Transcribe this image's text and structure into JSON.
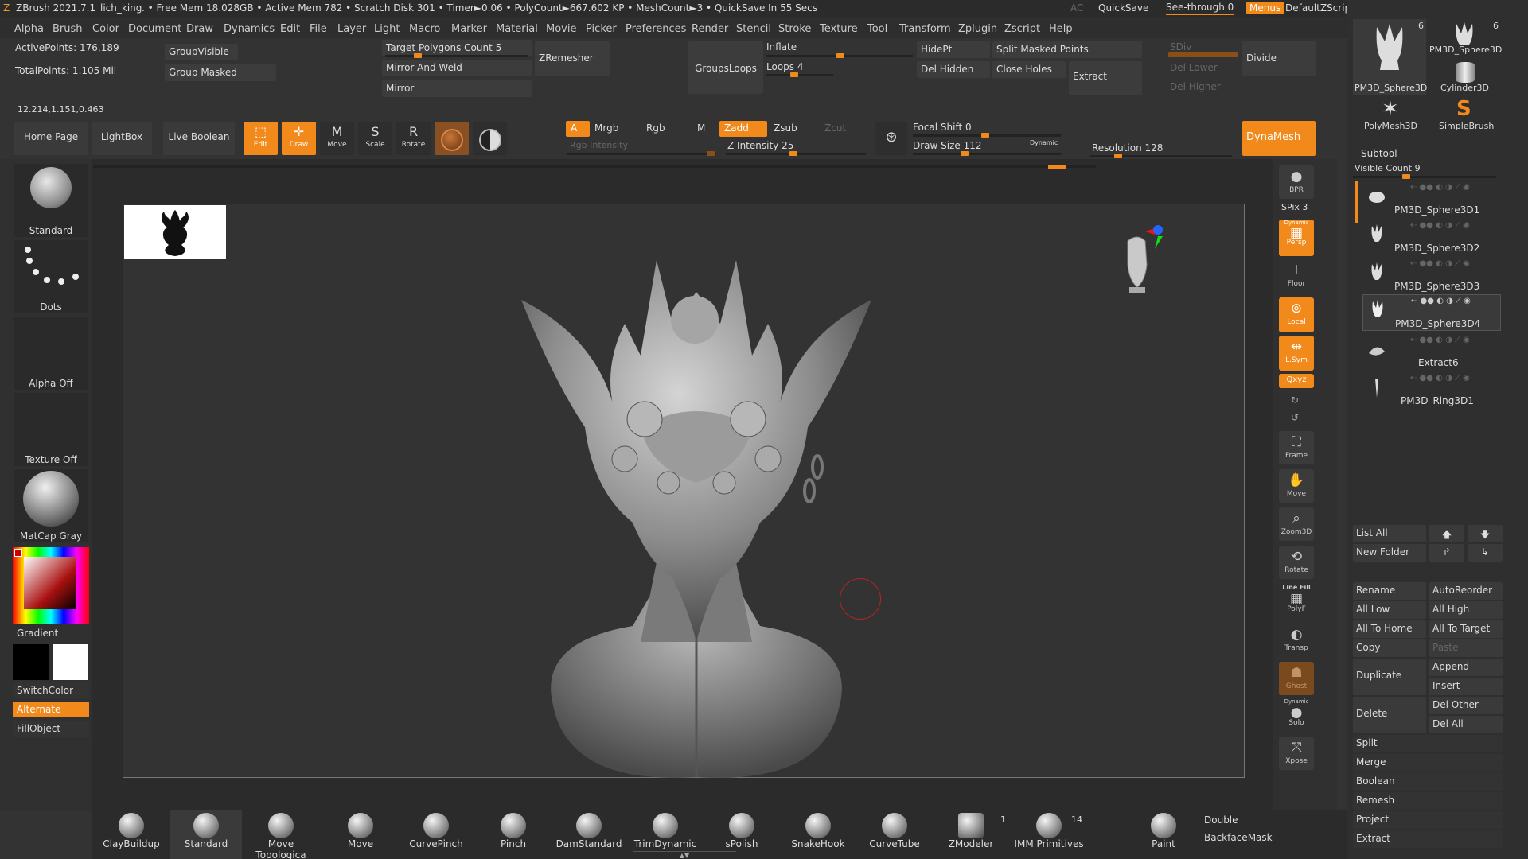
{
  "titlebar": {
    "app": "ZBrush 2021.7.1",
    "project": "lich_king",
    "stats": ". • Free Mem 18.028GB • Active Mem 782 • Scratch Disk 301 • Timer►0.06 • PolyCount►667.602 KP • MeshCount►3 • QuickSave In 55 Secs",
    "ac": "AC",
    "quicksave": "QuickSave",
    "see_through": "See-through 0",
    "menus": "Menus",
    "script": "DefaultZScript"
  },
  "menubar": [
    "Alpha",
    "Brush",
    "Color",
    "Document",
    "Draw",
    "Dynamics",
    "Edit",
    "File",
    "Layer",
    "Light",
    "Macro",
    "Marker",
    "Material",
    "Movie",
    "Picker",
    "Preferences",
    "Render",
    "Stencil",
    "Stroke",
    "Texture",
    "Tool",
    "Transform",
    "Zplugin",
    "Zscript",
    "Help"
  ],
  "info": {
    "active_points": "ActivePoints: 176,189",
    "total_points": "TotalPoints: 1.105 Mil",
    "coords": "12.214,1.151,0.463"
  },
  "topshelf": {
    "group_visible": "GroupVisible",
    "group_masked": "Group Masked",
    "target_polys": "Target Polygons Count 5",
    "mirror_weld": "Mirror And Weld",
    "mirror": "Mirror",
    "zremesher": "ZRemesher",
    "groups_loops": "GroupsLoops",
    "inflate": "Inflate",
    "loops": "Loops 4",
    "hidept": "HidePt",
    "split_masked": "Split Masked Points",
    "del_hidden": "Del Hidden",
    "close_holes": "Close Holes",
    "extract": "Extract",
    "sdiv": "SDiv",
    "divide": "Divide",
    "del_lower": "Del Lower",
    "del_higher": "Del Higher",
    "home_page": "Home Page",
    "lightbox": "LightBox",
    "live_boolean": "Live Boolean",
    "edit": "Edit",
    "draw": "Draw",
    "move": "Move",
    "scale": "Scale",
    "rotate": "Rotate",
    "a": "A",
    "mrgb": "Mrgb",
    "rgb": "Rgb",
    "m": "M",
    "zadd": "Zadd",
    "zsub": "Zsub",
    "zcut": "Zcut",
    "rgb_intensity": "Rgb Intensity",
    "z_intensity": "Z Intensity 25",
    "focal_shift": "Focal Shift 0",
    "draw_size": "Draw Size 112",
    "dynamic": "Dynamic",
    "resolution": "Resolution 128",
    "dynamesh": "DynaMesh"
  },
  "leftshelf": {
    "standard": "Standard",
    "dots": "Dots",
    "alpha_off": "Alpha Off",
    "texture_off": "Texture Off",
    "matcap": "MatCap Gray",
    "gradient": "Gradient",
    "switch_color": "SwitchColor",
    "alternate": "Alternate",
    "fill_object": "FillObject"
  },
  "rightshelf": {
    "bpr": "BPR",
    "spix": "SPix 3",
    "persp": "Persp",
    "persp_top": "Dynamic",
    "floor": "Floor",
    "local": "Local",
    "lsym": "L.Sym",
    "xyz": "Qxyz",
    "frame": "Frame",
    "move": "Move",
    "zoom3d": "Zoom3D",
    "rotate": "Rotate",
    "linefill": "Line Fill",
    "polyf": "PolyF",
    "transp": "Transp",
    "ghost": "Ghost",
    "solo_top": "Dynamic",
    "solo": "Solo",
    "xpose": "Xpose"
  },
  "tray": {
    "tools": [
      {
        "name": "PM3D_Sphere3D",
        "count": "6"
      },
      {
        "name": "PM3D_Sphere3D",
        "count": "6"
      },
      {
        "name": "Cylinder3D",
        "count": ""
      },
      {
        "name": "PolyMesh3D",
        "count": ""
      },
      {
        "name": "SimpleBrush",
        "count": ""
      }
    ],
    "subtool_header": "Subtool",
    "visible_count": "Visible Count 9",
    "subtools": [
      "PM3D_Sphere3D1",
      "PM3D_Sphere3D2",
      "PM3D_Sphere3D3",
      "PM3D_Sphere3D4",
      "Extract6",
      "PM3D_Ring3D1"
    ],
    "list_all": "List All",
    "new_folder": "New Folder",
    "rename": "Rename",
    "autoreorder": "AutoReorder",
    "all_low": "All Low",
    "all_high": "All High",
    "all_to_home": "All To Home",
    "all_to_target": "All To Target",
    "copy": "Copy",
    "paste": "Paste",
    "duplicate": "Duplicate",
    "append": "Append",
    "insert": "Insert",
    "delete": "Delete",
    "del_other": "Del Other",
    "del_all": "Del All",
    "split": "Split",
    "merge": "Merge",
    "boolean": "Boolean",
    "remesh": "Remesh",
    "project": "Project",
    "extract": "Extract"
  },
  "bottom": {
    "brushes": [
      "ClayBuildup",
      "Standard",
      "Move Topologica",
      "Move",
      "CurvePinch",
      "Pinch",
      "DamStandard",
      "TrimDynamic",
      "sPolish",
      "SnakeHook",
      "CurveTube",
      "ZModeler",
      "IMM Primitives",
      "Paint"
    ],
    "zmodeler_count": "1",
    "imm_count": "14",
    "double": "Double",
    "backface": "BackfaceMask"
  },
  "colors": {
    "accent": "#f2891b",
    "panel": "#333333",
    "dark": "#2b2b2b"
  }
}
